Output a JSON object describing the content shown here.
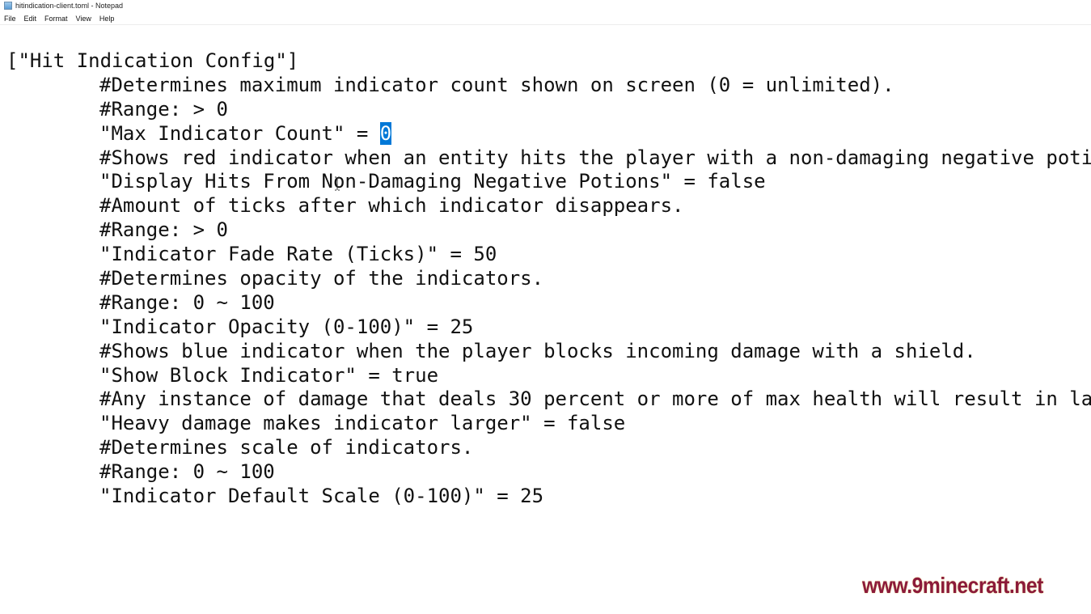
{
  "window": {
    "title": "hitindication-client.toml - Notepad",
    "icon": "notepad-icon"
  },
  "menu": {
    "items": [
      "File",
      "Edit",
      "Format",
      "View",
      "Help"
    ]
  },
  "editor": {
    "lines": [
      {
        "indent": false,
        "text": "[\"Hit Indication Config\"]"
      },
      {
        "indent": true,
        "text": "#Determines maximum indicator count shown on screen (0 = unlimited)."
      },
      {
        "indent": true,
        "text": "#Range: > 0"
      },
      {
        "indent": true,
        "text": "\"Max Indicator Count\" = ",
        "selected": "0"
      },
      {
        "indent": true,
        "text": "#Shows red indicator when an entity hits the player with a non-damaging negative poti"
      },
      {
        "indent": true,
        "text": "\"Display Hits From Non-Damaging Negative Potions\" = false"
      },
      {
        "indent": true,
        "text": "#Amount of ticks after which indicator disappears."
      },
      {
        "indent": true,
        "text": "#Range: > 0"
      },
      {
        "indent": true,
        "text": "\"Indicator Fade Rate (Ticks)\" = 50"
      },
      {
        "indent": true,
        "text": "#Determines opacity of the indicators."
      },
      {
        "indent": true,
        "text": "#Range: 0 ~ 100"
      },
      {
        "indent": true,
        "text": "\"Indicator Opacity (0-100)\" = 25"
      },
      {
        "indent": true,
        "text": "#Shows blue indicator when the player blocks incoming damage with a shield."
      },
      {
        "indent": true,
        "text": "\"Show Block Indicator\" = true"
      },
      {
        "indent": true,
        "text": "#Any instance of damage that deals 30 percent or more of max health will result in la"
      },
      {
        "indent": true,
        "text": "\"Heavy damage makes indicator larger\" = false"
      },
      {
        "indent": true,
        "text": "#Determines scale of indicators."
      },
      {
        "indent": true,
        "text": "#Range: 0 ~ 100"
      },
      {
        "indent": true,
        "text": "\"Indicator Default Scale (0-100)\" = 25"
      }
    ],
    "selection_color": "#0078d7"
  },
  "watermark": {
    "text": "www.9minecraft.net",
    "color": "#8b1a3a"
  }
}
